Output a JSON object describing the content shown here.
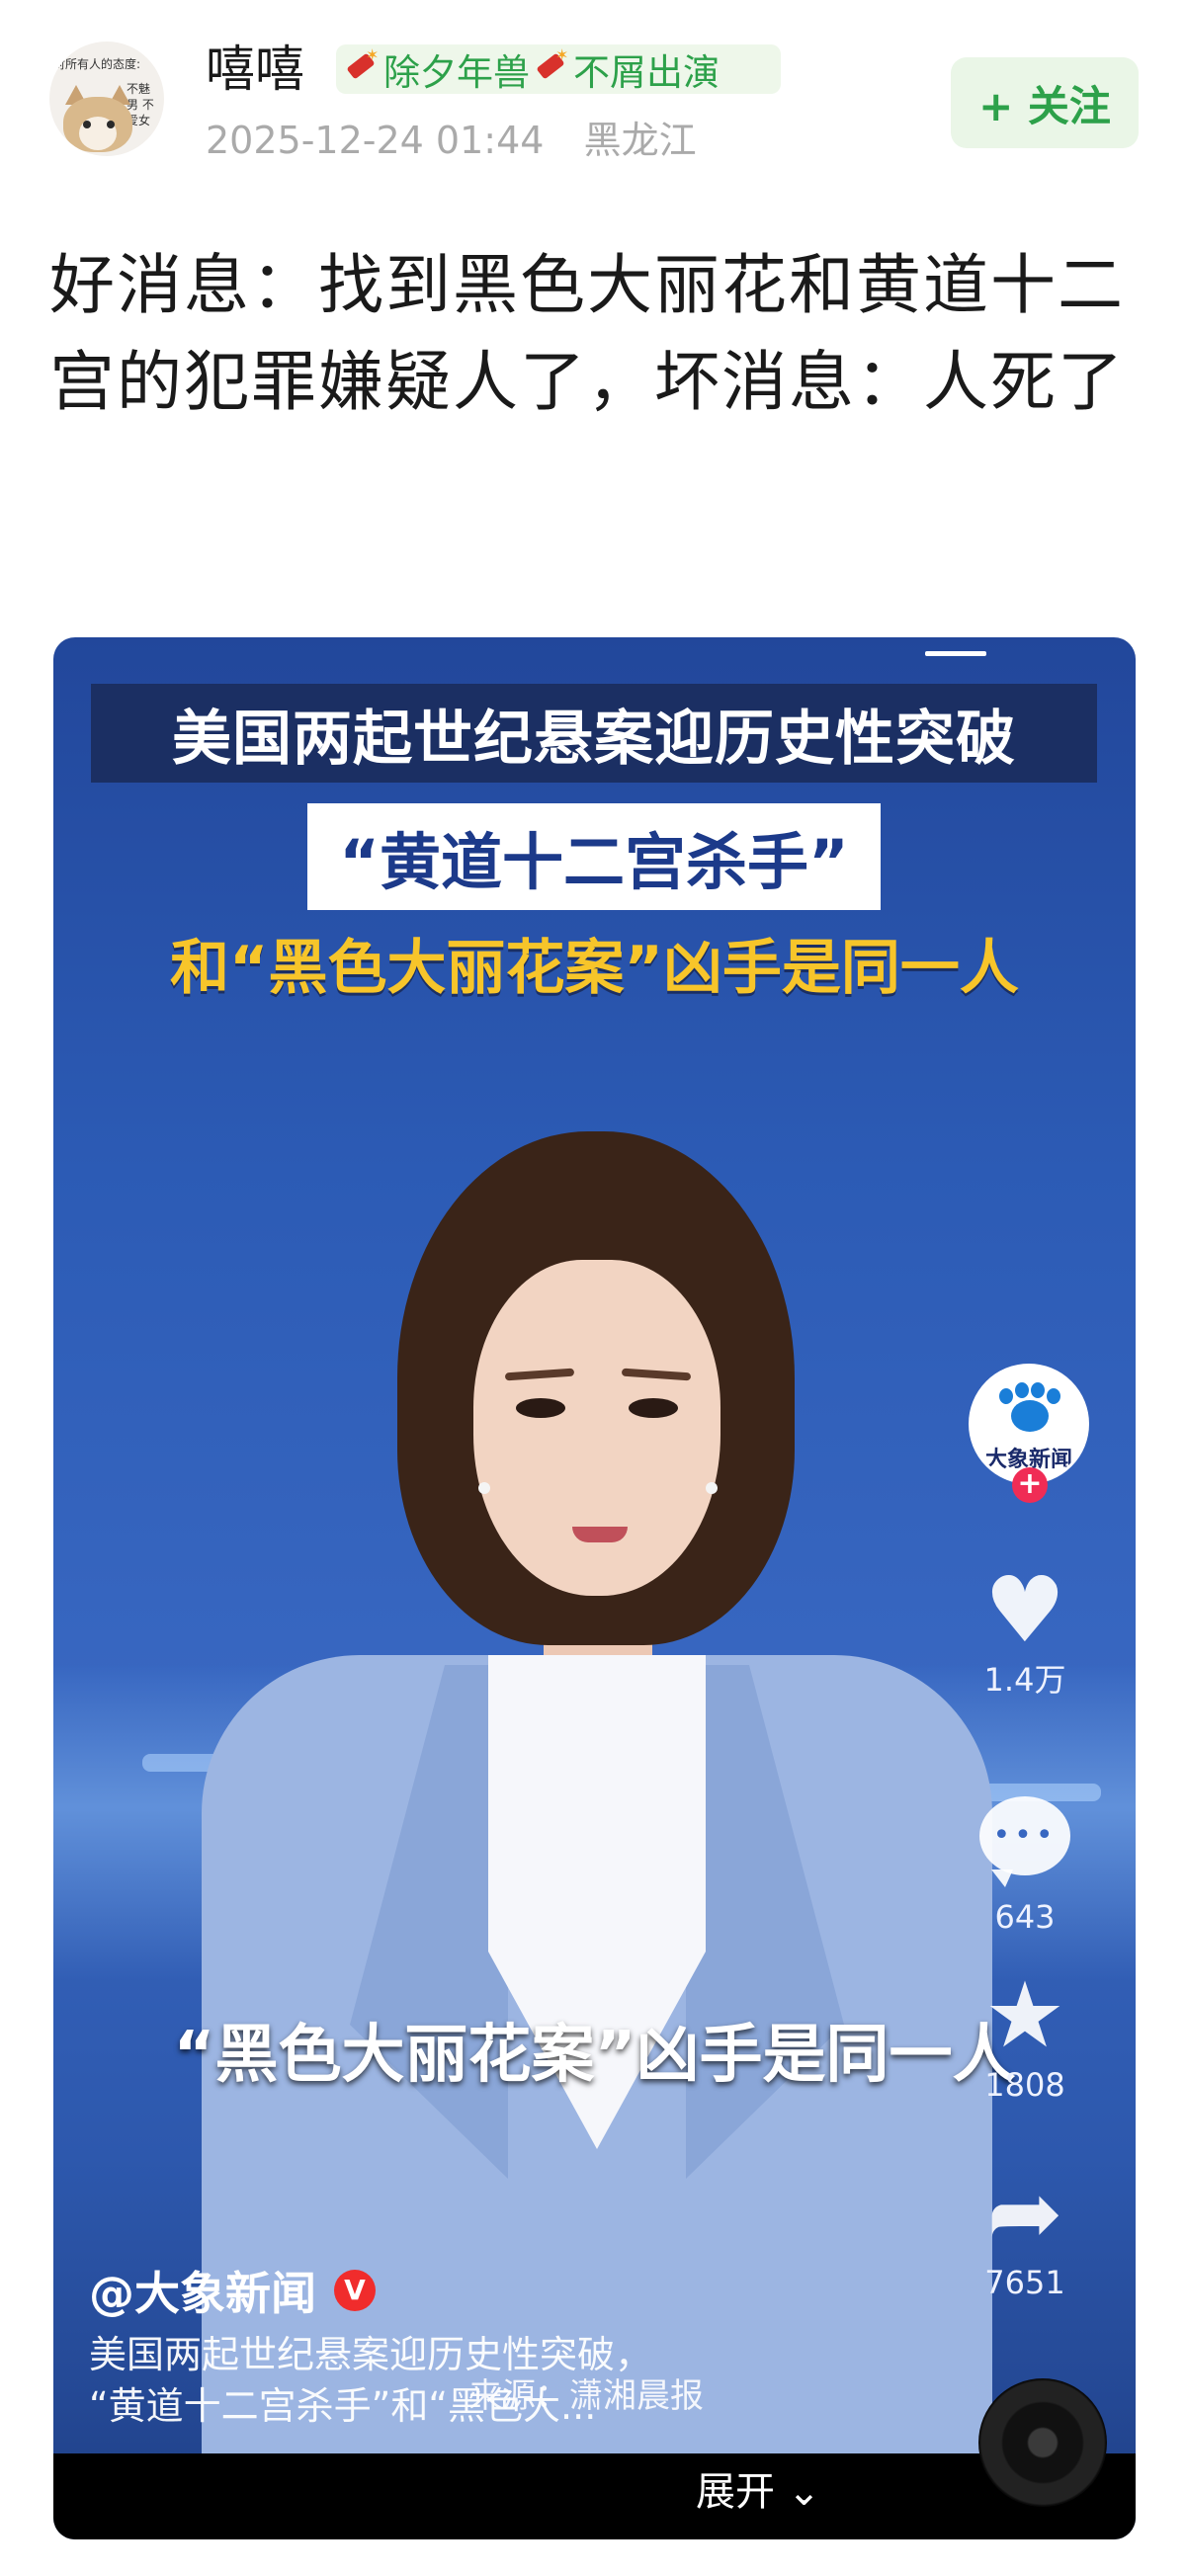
{
  "post": {
    "avatar_caption_top": "对所有人的态度:",
    "avatar_caption_side": "不魅男 不爱女",
    "username": "嘻嘻",
    "tag_left": "除夕年兽",
    "tag_right": "不屑出演",
    "datetime": "2025-12-24 01:44",
    "location": "黑龙江",
    "follow_label": "+ 关注",
    "headline": "好消息：找到黑色大丽花和黄道十二宫的犯罪嫌疑人了，坏消息：人死了"
  },
  "video": {
    "banner_line1": "美国两起世纪悬案迎历史性突破",
    "banner_line2": "“黄道十二宫杀手”",
    "banner_line3": "和“黑色大丽花案”凶手是同一人",
    "subtitle": "“黑色大丽花案”凶手是同一人",
    "channel_logo_text": "大象新闻",
    "follow_plus": "+",
    "like_icon": "heart-icon",
    "like_count": "1.4万",
    "comment_icon": "comment-icon",
    "comment_count": "643",
    "favorite_icon": "star-icon",
    "favorite_count": "1808",
    "share_icon": "share-icon",
    "share_count": "7651",
    "author": "@大象新闻",
    "verified_badge": "V",
    "description_line1": "美国两起世纪悬案迎历史性突破，",
    "description_line2": "“黄道十二宫杀手”和“黑色大...",
    "source": "来源：潇湘晨报",
    "expand_label": "展开",
    "colors": {
      "accent_green": "#2da14a",
      "banner_navy": "#1b2f63",
      "banner_yellow": "#f7c52a",
      "badge_red": "#f02c55"
    }
  }
}
